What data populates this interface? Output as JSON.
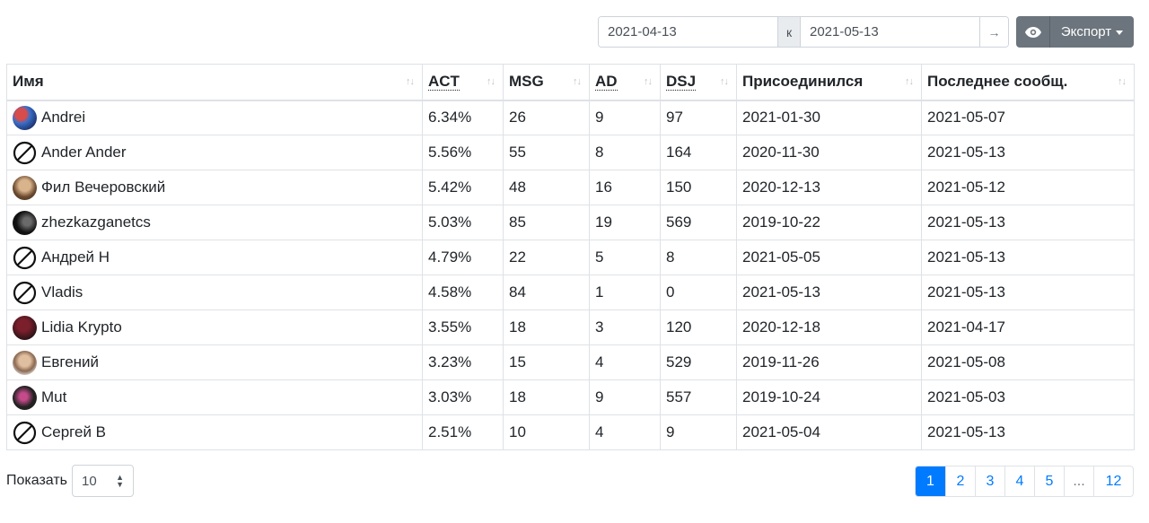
{
  "filter": {
    "date_from": "2021-04-13",
    "separator": "к",
    "date_to": "2021-05-13",
    "go_label": "→",
    "export_label": "Экспорт"
  },
  "table": {
    "headers": [
      "Имя",
      "ACT",
      "MSG",
      "AD",
      "DSJ",
      "Присоединился",
      "Последнее сообщ."
    ],
    "rows": [
      {
        "name": "Andrei",
        "avatar": "photo",
        "act": "6.34%",
        "msg": "26",
        "ad": "9",
        "dsj": "97",
        "joined": "2021-01-30",
        "last": "2021-05-07"
      },
      {
        "name": "Ander Ander",
        "avatar": "none",
        "act": "5.56%",
        "msg": "55",
        "ad": "8",
        "dsj": "164",
        "joined": "2020-11-30",
        "last": "2021-05-13"
      },
      {
        "name": "Фил Вечеровский",
        "avatar": "photo",
        "act": "5.42%",
        "msg": "48",
        "ad": "16",
        "dsj": "150",
        "joined": "2020-12-13",
        "last": "2021-05-12"
      },
      {
        "name": "zhezkazganetcs",
        "avatar": "photo",
        "act": "5.03%",
        "msg": "85",
        "ad": "19",
        "dsj": "569",
        "joined": "2019-10-22",
        "last": "2021-05-13"
      },
      {
        "name": "Андрей Н",
        "avatar": "none",
        "act": "4.79%",
        "msg": "22",
        "ad": "5",
        "dsj": "8",
        "joined": "2021-05-05",
        "last": "2021-05-13"
      },
      {
        "name": "Vladis",
        "avatar": "none",
        "act": "4.58%",
        "msg": "84",
        "ad": "1",
        "dsj": "0",
        "joined": "2021-05-13",
        "last": "2021-05-13"
      },
      {
        "name": "Lidia Krypto",
        "avatar": "photo",
        "act": "3.55%",
        "msg": "18",
        "ad": "3",
        "dsj": "120",
        "joined": "2020-12-18",
        "last": "2021-04-17"
      },
      {
        "name": "Евгений",
        "avatar": "photo",
        "act": "3.23%",
        "msg": "15",
        "ad": "4",
        "dsj": "529",
        "joined": "2019-11-26",
        "last": "2021-05-08"
      },
      {
        "name": "Mut",
        "avatar": "photo",
        "act": "3.03%",
        "msg": "18",
        "ad": "9",
        "dsj": "557",
        "joined": "2019-10-24",
        "last": "2021-05-03"
      },
      {
        "name": "Сергей В",
        "avatar": "none",
        "act": "2.51%",
        "msg": "10",
        "ad": "4",
        "dsj": "9",
        "joined": "2021-05-04",
        "last": "2021-05-13"
      }
    ]
  },
  "footer": {
    "show_label": "Показать",
    "page_size": "10",
    "pages": [
      "1",
      "2",
      "3",
      "4",
      "5",
      "...",
      "12"
    ],
    "active_page": "1"
  },
  "colors": {
    "accent": "#007bff",
    "button": "#6c757d",
    "border": "#dee2e6"
  }
}
